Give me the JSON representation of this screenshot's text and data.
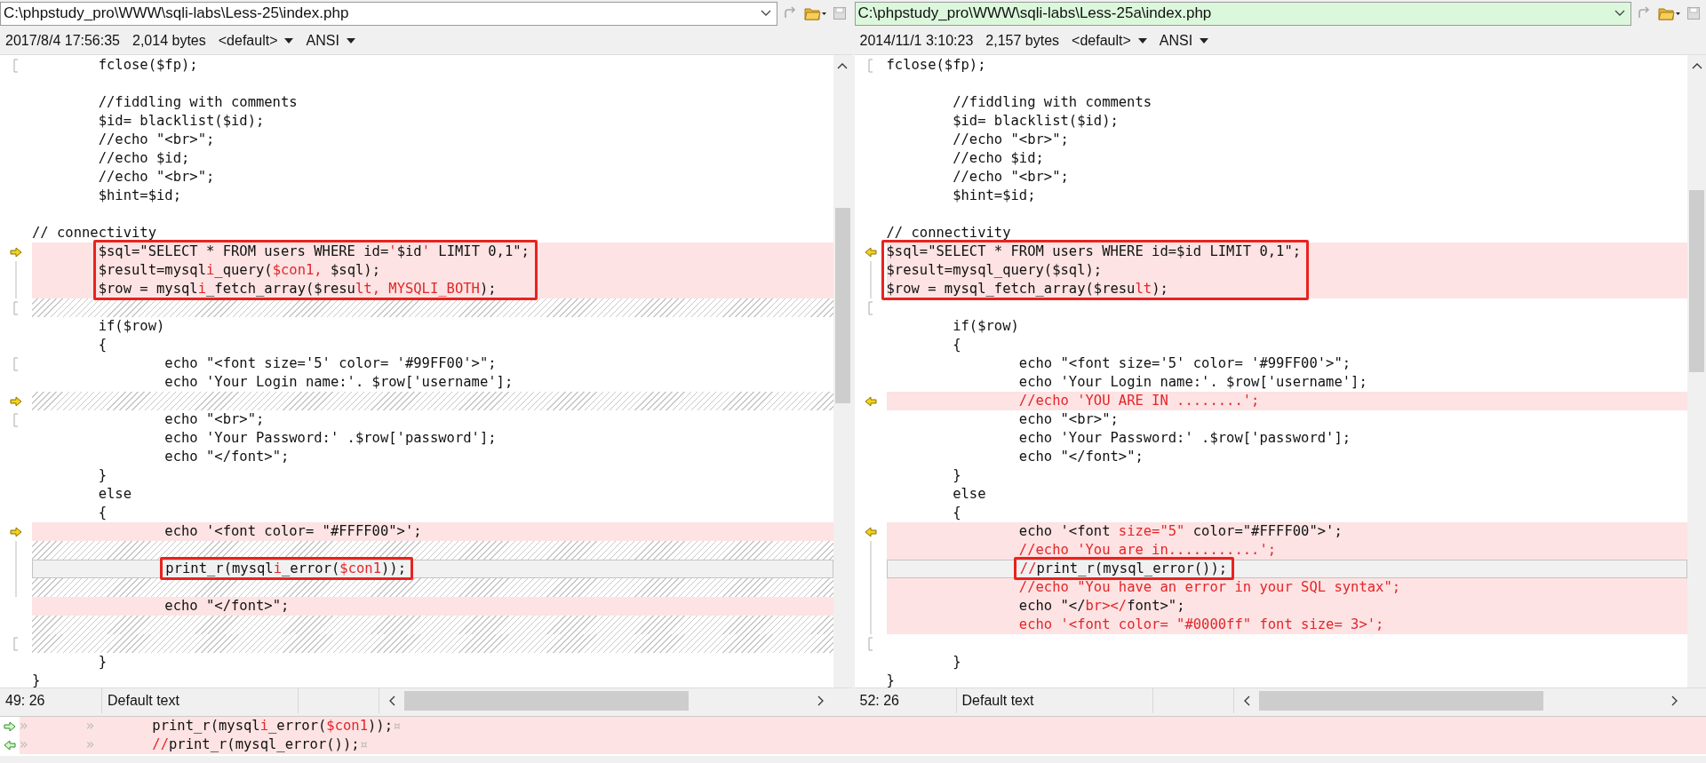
{
  "panes": [
    {
      "path": "C:\\phpstudy_pro\\WWW\\sqli-labs\\Less-25\\index.php",
      "active": false,
      "date": "2017/8/4 17:56:35",
      "size": "2,014 bytes",
      "codepage": "<default>",
      "encoding": "ANSI",
      "status": {
        "position": "49: 26",
        "style": "Default text"
      },
      "lines": [
        {
          "kind": "same",
          "bracket": true,
          "text": "        fclose($fp);"
        },
        {
          "kind": "same"
        },
        {
          "kind": "same",
          "text": "        //fiddling with comments"
        },
        {
          "kind": "same",
          "text": "        $id= blacklist($id);"
        },
        {
          "kind": "same",
          "text": "        //echo \"<br>\";"
        },
        {
          "kind": "same",
          "text": "        //echo $id;"
        },
        {
          "kind": "same",
          "text": "        //echo \"<br>\";"
        },
        {
          "kind": "same",
          "text": "        $hint=$id;"
        },
        {
          "kind": "same"
        },
        {
          "kind": "same",
          "text": "// connectivity"
        },
        {
          "kind": "diff",
          "arrow": true,
          "boxed": true,
          "segments": [
            {
              "text": "        $sql=\"SELECT * FROM users WHERE id=",
              "changed": false
            },
            {
              "text": "'",
              "changed": true
            },
            {
              "text": "$id",
              "changed": false
            },
            {
              "text": "'",
              "changed": true
            },
            {
              "text": " LIMIT 0,1\";",
              "changed": false
            }
          ]
        },
        {
          "kind": "diff",
          "bar": true,
          "boxed": true,
          "segments": [
            {
              "text": "        $result=mysql",
              "changed": false
            },
            {
              "text": "i",
              "changed": true
            },
            {
              "text": "_query(",
              "changed": false
            },
            {
              "text": "$con1,",
              "changed": true
            },
            {
              "text": " $sql);",
              "changed": false
            }
          ]
        },
        {
          "kind": "diff",
          "bar": true,
          "boxed": true,
          "segments": [
            {
              "text": "        $row = mysql",
              "changed": false
            },
            {
              "text": "i",
              "changed": true
            },
            {
              "text": "_fetch_array($resu",
              "changed": false
            },
            {
              "text": "lt, MYSQLI_BOTH",
              "changed": true
            },
            {
              "text": ");",
              "changed": false
            }
          ]
        },
        {
          "kind": "gap",
          "bracket": true
        },
        {
          "kind": "same",
          "text": "        if($row)"
        },
        {
          "kind": "same",
          "text": "        {"
        },
        {
          "kind": "same",
          "bracket": true,
          "text": "                echo \"<font size='5' color= '#99FF00'>\";"
        },
        {
          "kind": "same",
          "text": "                echo 'Your Login name:'. $row['username'];"
        },
        {
          "kind": "gap",
          "arrow": true
        },
        {
          "kind": "same",
          "bracket": true,
          "text": "                echo \"<br>\";"
        },
        {
          "kind": "same",
          "text": "                echo 'Your Password:' .$row['password'];"
        },
        {
          "kind": "same",
          "text": "                echo \"</font>\";"
        },
        {
          "kind": "same",
          "text": "        }"
        },
        {
          "kind": "same",
          "text": "        else"
        },
        {
          "kind": "same",
          "text": "        {"
        },
        {
          "kind": "diff",
          "arrow": true,
          "text": "                echo '<font color= \"#FFFF00\">';"
        },
        {
          "kind": "gap",
          "bar": true
        },
        {
          "kind": "current",
          "bar": true,
          "boxed": true,
          "segments": [
            {
              "text": "                print_r(mysql",
              "changed": false
            },
            {
              "text": "i",
              "changed": true
            },
            {
              "text": "_error(",
              "changed": false
            },
            {
              "text": "$con1",
              "changed": true
            },
            {
              "text": "));",
              "changed": false
            }
          ]
        },
        {
          "kind": "gap",
          "bar": true
        },
        {
          "kind": "diff",
          "text": "                echo \"</font>\";"
        },
        {
          "kind": "gap"
        },
        {
          "kind": "gap",
          "bracket": true
        },
        {
          "kind": "same",
          "text": "        }"
        },
        {
          "kind": "same",
          "text": "}"
        }
      ]
    },
    {
      "path": "C:\\phpstudy_pro\\WWW\\sqli-labs\\Less-25a\\index.php",
      "active": true,
      "date": "2014/11/1 3:10:23",
      "size": "2,157 bytes",
      "codepage": "<default>",
      "encoding": "ANSI",
      "status": {
        "position": "52: 26",
        "style": "Default text"
      },
      "lines": [
        {
          "kind": "same",
          "bracket": true,
          "text": "fclose($fp);"
        },
        {
          "kind": "same"
        },
        {
          "kind": "same",
          "text": "        //fiddling with comments"
        },
        {
          "kind": "same",
          "text": "        $id= blacklist($id);"
        },
        {
          "kind": "same",
          "text": "        //echo \"<br>\";"
        },
        {
          "kind": "same",
          "text": "        //echo $id;"
        },
        {
          "kind": "same",
          "text": "        //echo \"<br>\";"
        },
        {
          "kind": "same",
          "text": "        $hint=$id;"
        },
        {
          "kind": "same"
        },
        {
          "kind": "same",
          "text": "// connectivity"
        },
        {
          "kind": "diff",
          "arrow": true,
          "boxed": true,
          "text": "$sql=\"SELECT * FROM users WHERE id=$id LIMIT 0,1\";"
        },
        {
          "kind": "diff",
          "bar": true,
          "boxed": true,
          "text": "$result=mysql_query($sql);"
        },
        {
          "kind": "diff",
          "bar": true,
          "boxed": true,
          "segments": [
            {
              "text": "$row = mysql_fetch_array($resu",
              "changed": false
            },
            {
              "text": "lt",
              "changed": true
            },
            {
              "text": ");",
              "changed": false
            }
          ]
        },
        {
          "kind": "same",
          "bracket": true
        },
        {
          "kind": "same",
          "text": "        if($row)"
        },
        {
          "kind": "same",
          "text": "        {"
        },
        {
          "kind": "same",
          "text": "                echo \"<font size='5' color= '#99FF00'>\";"
        },
        {
          "kind": "same",
          "text": "                echo 'Your Login name:'. $row['username'];"
        },
        {
          "kind": "diff",
          "arrow": true,
          "segments": [
            {
              "text": "                //echo 'YOU ARE IN ........';",
              "changed": true
            }
          ]
        },
        {
          "kind": "same",
          "text": "                echo \"<br>\";"
        },
        {
          "kind": "same",
          "text": "                echo 'Your Password:' .$row['password'];"
        },
        {
          "kind": "same",
          "text": "                echo \"</font>\";"
        },
        {
          "kind": "same",
          "text": "        }"
        },
        {
          "kind": "same",
          "text": "        else"
        },
        {
          "kind": "same",
          "text": "        {"
        },
        {
          "kind": "diff",
          "arrow": true,
          "segments": [
            {
              "text": "                echo '<font ",
              "changed": false
            },
            {
              "text": "size=\"5\"",
              "changed": true
            },
            {
              "text": " color=\"#FFFF00\">';",
              "changed": false
            }
          ]
        },
        {
          "kind": "diff",
          "bar": true,
          "segments": [
            {
              "text": "                //echo 'You are in...........';",
              "changed": true
            }
          ]
        },
        {
          "kind": "current",
          "bar": true,
          "boxed": true,
          "segments": [
            {
              "text": "                //",
              "changed": true
            },
            {
              "text": "print_r(mysql_error());",
              "changed": false
            }
          ]
        },
        {
          "kind": "diff",
          "bar": true,
          "segments": [
            {
              "text": "                //echo \"You have an error in your SQL syntax\";",
              "changed": true
            }
          ]
        },
        {
          "kind": "diff",
          "bar": true,
          "segments": [
            {
              "text": "                echo \"</",
              "changed": false
            },
            {
              "text": "br></",
              "changed": true
            },
            {
              "text": "font>\";",
              "changed": false
            }
          ]
        },
        {
          "kind": "diff",
          "bar": true,
          "segments": [
            {
              "text": "                echo '<font color= \"#0000ff\" font size= 3>';",
              "changed": true
            }
          ]
        },
        {
          "kind": "same",
          "bracket": true
        },
        {
          "kind": "same",
          "text": "        }"
        },
        {
          "kind": "same",
          "text": "}"
        }
      ]
    }
  ],
  "detail_lines": [
    {
      "segments": [
        {
          "text": "»       »       ",
          "kind": "symbol"
        },
        {
          "text": "print_r(mysql",
          "kind": "plain"
        },
        {
          "text": "i",
          "kind": "changed"
        },
        {
          "text": "_error(",
          "kind": "plain"
        },
        {
          "text": "$con1",
          "kind": "changed"
        },
        {
          "text": "));",
          "kind": "plain"
        },
        {
          "text": "¤",
          "kind": "symbol"
        }
      ]
    },
    {
      "segments": [
        {
          "text": "»       »       ",
          "kind": "symbol"
        },
        {
          "text": "//",
          "kind": "changed"
        },
        {
          "text": "print_r(mysql_error());",
          "kind": "plain"
        },
        {
          "text": "¤",
          "kind": "symbol"
        }
      ]
    }
  ]
}
